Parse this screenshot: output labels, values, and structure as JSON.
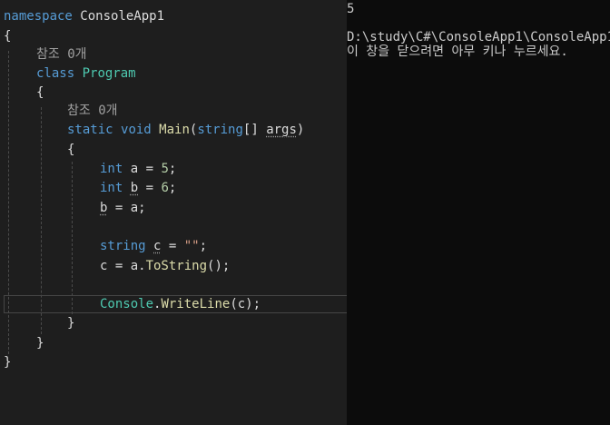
{
  "editor": {
    "line1": {
      "kw": "namespace",
      "name": "ConsoleApp1"
    },
    "brace_open_ns": "{",
    "ref1": "참조 0개",
    "line_class": {
      "kw": "class",
      "name": "Program"
    },
    "brace_open_class": "{",
    "ref2": "참조 0개",
    "line_main": {
      "static": "static",
      "void": "void",
      "fn": "Main",
      "paren_open": "(",
      "type": "string",
      "brackets": "[]",
      "arg": "args",
      "paren_close": ")"
    },
    "brace_open_main": "{",
    "line_a": {
      "kw": "int",
      "var": "a",
      "rest": " = ",
      "num": "5",
      "semi": ";"
    },
    "line_b": {
      "kw": "int",
      "var": "b",
      "rest": " = ",
      "num": "6",
      "semi": ";"
    },
    "line_assign": {
      "var": "b",
      "rest": " = a;"
    },
    "line_str": {
      "kw": "string",
      "var": "c",
      "rest": " = ",
      "str": "\"\"",
      "semi": ";"
    },
    "line_tostring": {
      "pre": "c = a.",
      "fn": "ToString",
      "post": "();"
    },
    "line_console": {
      "cls": "Console",
      "dot": ".",
      "fn": "WriteLine",
      "post": "(c);"
    },
    "brace_close_main": "}",
    "brace_close_class": "}",
    "brace_close_ns": "}"
  },
  "console": {
    "output": "5",
    "path": "D:\\study\\C#\\ConsoleApp1\\ConsoleApp1\\",
    "prompt": "이 창을 닫으려면 아무 키나 누르세요."
  }
}
